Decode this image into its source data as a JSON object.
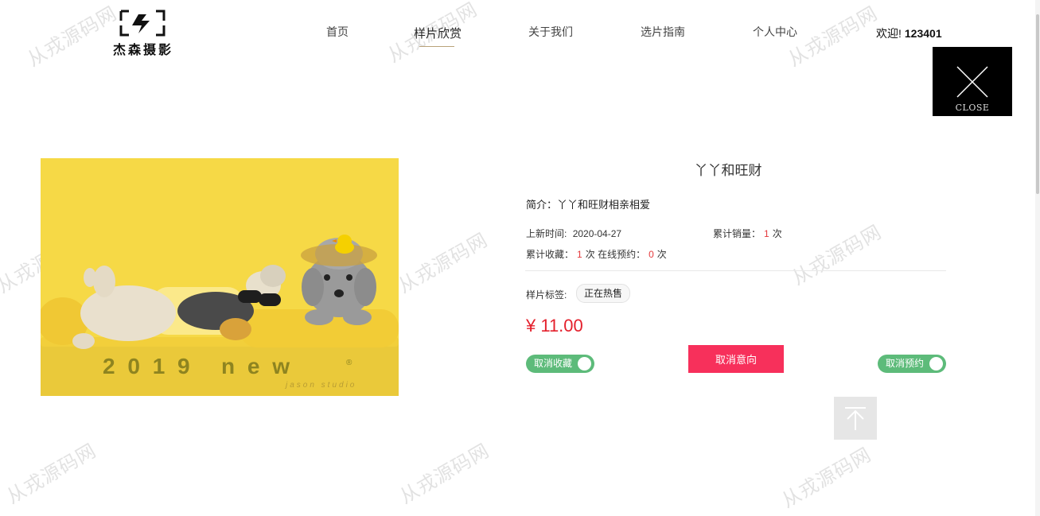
{
  "brand": {
    "logo_text": "杰森摄影"
  },
  "nav": {
    "items": [
      {
        "label": "首页"
      },
      {
        "label": "样片欣赏"
      },
      {
        "label": "关于我们"
      },
      {
        "label": "选片指南"
      },
      {
        "label": "个人中心"
      }
    ],
    "active_index": 1
  },
  "user": {
    "welcome": "欢迎!",
    "username": "123401"
  },
  "close": {
    "label": "CLOSE"
  },
  "photo": {
    "overlay_text": "2 0 1 9   n e w",
    "registered_mark": "®",
    "studio_text": "jason studio"
  },
  "product": {
    "title": "丫丫和旺财",
    "intro_label": "简介：",
    "intro": "丫丫和旺财相亲相爱",
    "listed_label": "上新时间:",
    "listed_date": "2020-04-27",
    "sales_label": "累计销量：",
    "sales_count": "1",
    "sales_unit": "次",
    "favorites_label": "累计收藏：",
    "favorites_count": "1",
    "favorites_unit": "次",
    "booking_label": "在线预约：",
    "booking_count": "0",
    "booking_unit": "次",
    "tag_label": "样片标签:",
    "tag": "正在热售",
    "price": "¥ 11.00"
  },
  "actions": {
    "unfavorite": "取消收藏",
    "cancel_intent": "取消意向",
    "cancel_booking": "取消预约"
  },
  "watermark": "从戎源码网",
  "colors": {
    "accent_red": "#f7305b",
    "price_red": "#e4202c",
    "toggle_green": "#5dbb7a",
    "photo_yellow": "#f7d84a"
  },
  "icons": [
    "close-icon",
    "arrow-up-icon"
  ]
}
